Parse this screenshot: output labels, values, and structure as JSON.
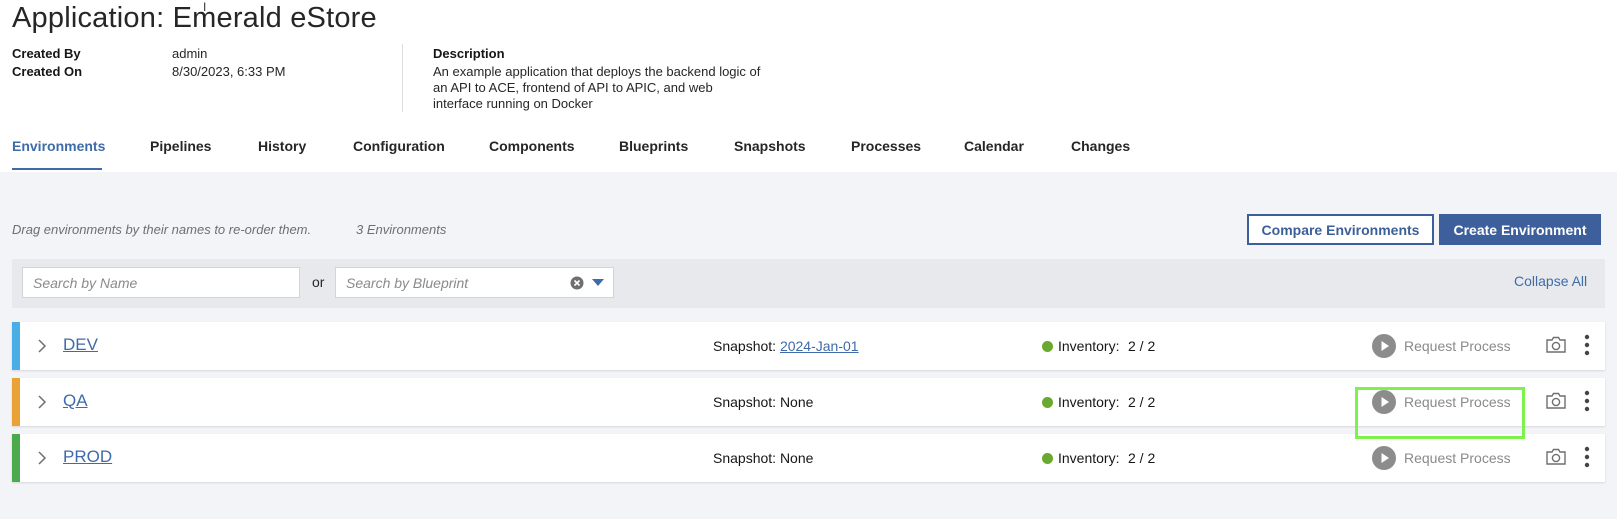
{
  "header": {
    "title": "Application: Emerald eStore",
    "created_by_label": "Created By",
    "created_by_value": "admin",
    "created_on_label": "Created On",
    "created_on_value": "8/30/2023, 6:33 PM",
    "description_label": "Description",
    "description_text": "An example application that deploys the backend logic of an API to ACE, frontend of API to APIC, and web interface running on Docker"
  },
  "tabs": [
    {
      "label": "Environments",
      "active": true
    },
    {
      "label": "Pipelines"
    },
    {
      "label": "History"
    },
    {
      "label": "Configuration"
    },
    {
      "label": "Components"
    },
    {
      "label": "Blueprints"
    },
    {
      "label": "Snapshots"
    },
    {
      "label": "Processes"
    },
    {
      "label": "Calendar"
    },
    {
      "label": "Changes"
    }
  ],
  "toolbar": {
    "hint": "Drag environments by their names to re-order them.",
    "count": "3 Environments",
    "compare_label": "Compare Environments",
    "create_label": "Create Environment"
  },
  "search": {
    "name_placeholder": "Search by Name",
    "or_text": "or",
    "blueprint_placeholder": "Search by Blueprint",
    "collapse_all": "Collapse All"
  },
  "environments": [
    {
      "name": "DEV",
      "color": "#4aaee6",
      "snapshot_label": "Snapshot:",
      "snapshot_value": "2024-Jan-01",
      "inventory_label": "Inventory:",
      "inventory_value": "2 / 2",
      "status_color": "#6aa832",
      "request_label": "Request Process"
    },
    {
      "name": "QA",
      "color": "#eaa136",
      "snapshot_label": "Snapshot: None",
      "inventory_label": "Inventory:",
      "inventory_value": "2 / 2",
      "status_color": "#6aa832",
      "request_label": "Request Process"
    },
    {
      "name": "PROD",
      "color": "#4caa4d",
      "snapshot_label": "Snapshot: None",
      "inventory_label": "Inventory:",
      "inventory_value": "2 / 2",
      "status_color": "#6aa832",
      "request_label": "Request Process"
    }
  ],
  "colors": {
    "accent": "#3f6ba8",
    "highlight": "#7df24d"
  },
  "icons": {
    "clear": "clear-circle-icon",
    "dropdown": "caret-down-icon",
    "expand": "chevron-right-icon",
    "request": "play-circle-icon",
    "snapshot": "camera-icon",
    "menu": "kebab-menu-icon"
  }
}
